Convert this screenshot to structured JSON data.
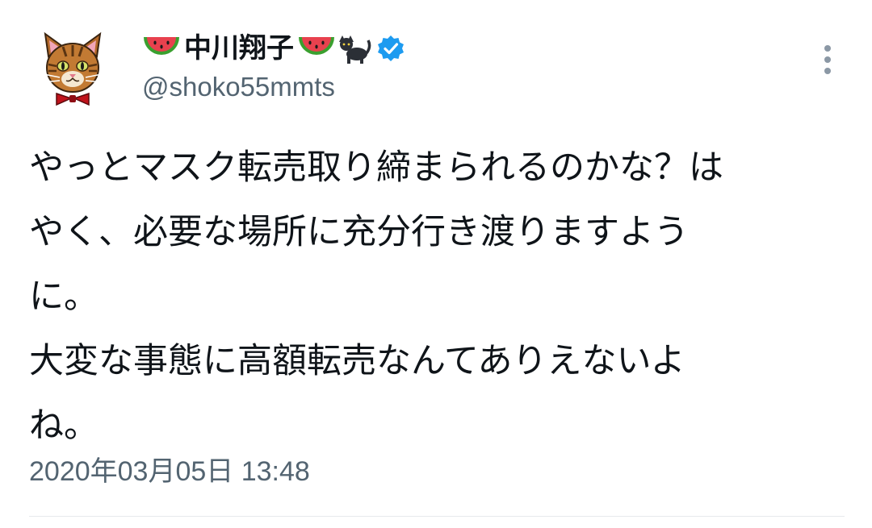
{
  "tweet": {
    "display_name": "中川翔子",
    "handle": "@shoko55mmts",
    "body_lines": [
      "やっとマスク転売取り締まられるのかな？は",
      "やく、必要な場所に充分行き渡りますよう",
      "に。",
      "大変な事態に高額転売なんてありえないよ",
      "ね。"
    ],
    "timestamp": "2020年03月05日 13:48"
  },
  "icons": {
    "avatar": "cat-avatar",
    "name_prefix": "watermelon-icon",
    "name_suffix": [
      "watermelon-icon",
      "black-cat-icon"
    ],
    "verified": "verified-badge-icon",
    "menu": "more-options-icon"
  },
  "colors": {
    "text": "#0f1419",
    "secondary": "#536471",
    "verified": "#1d9bf0",
    "menu": "#8b98a5",
    "divider": "#e7eaec"
  }
}
